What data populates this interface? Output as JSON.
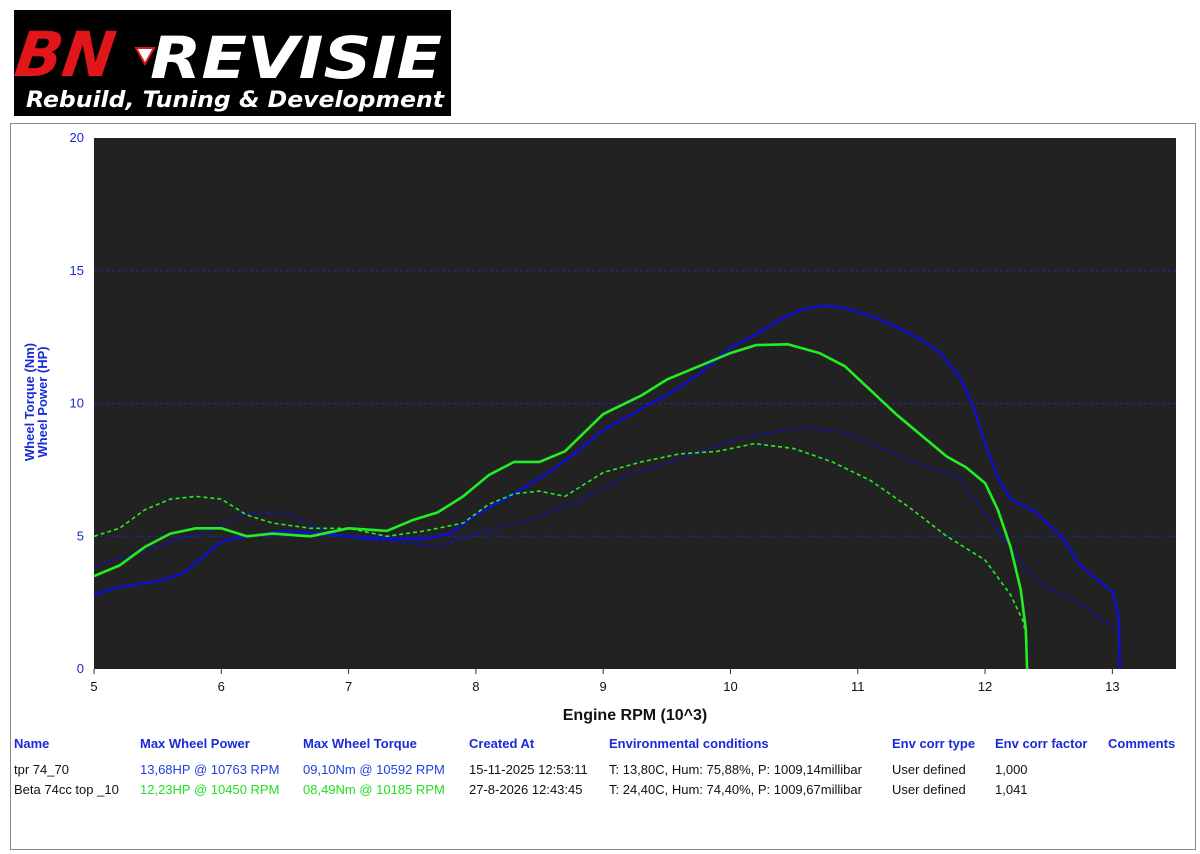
{
  "logo": {
    "brand_red": "BN",
    "brand_white": "REVISIE",
    "tagline": "Rebuild, Tuning & Development"
  },
  "colors": {
    "plot_bg": "#222222",
    "grid": "#1a2ad8",
    "blue": "#1010c8",
    "green": "#22ee22",
    "axis_text": "#1a2ad8"
  },
  "chart_data": {
    "type": "line",
    "xlabel": "Engine RPM (10^3)",
    "ylabel_lines": [
      "Wheel Torque (Nm)",
      "Wheel Power (HP)"
    ],
    "xlim": [
      5,
      13.5
    ],
    "ylim": [
      0,
      20
    ],
    "x_ticks": [
      "5",
      "6",
      "7",
      "8",
      "9",
      "10",
      "11",
      "12",
      "13"
    ],
    "y_ticks": [
      "0",
      "5",
      "10",
      "15",
      "20"
    ],
    "grid": "horizontal dashed",
    "series": [
      {
        "name": "tpr 74_70",
        "metric": "power",
        "color": "blue",
        "dash": false,
        "x": [
          5.0,
          5.2,
          5.5,
          5.7,
          5.85,
          6.0,
          6.2,
          6.5,
          6.8,
          7.0,
          7.3,
          7.6,
          7.8,
          8.0,
          8.3,
          8.6,
          8.8,
          9.0,
          9.3,
          9.6,
          9.8,
          10.0,
          10.2,
          10.4,
          10.6,
          10.76,
          10.9,
          11.1,
          11.3,
          11.5,
          11.65,
          11.8,
          11.9,
          12.0,
          12.1,
          12.2,
          12.4,
          12.6,
          12.75,
          12.9,
          13.0,
          13.05,
          13.06
        ],
        "y": [
          2.8,
          3.1,
          3.3,
          3.6,
          4.2,
          4.8,
          5.0,
          5.2,
          5.1,
          5.0,
          4.9,
          4.9,
          5.1,
          5.8,
          6.6,
          7.5,
          8.2,
          9.0,
          9.8,
          10.6,
          11.3,
          12.1,
          12.6,
          13.2,
          13.6,
          13.68,
          13.6,
          13.3,
          12.9,
          12.4,
          11.9,
          11.0,
          10.0,
          8.5,
          7.2,
          6.4,
          5.9,
          5.0,
          3.9,
          3.3,
          2.9,
          2.0,
          0.0
        ]
      },
      {
        "name": "tpr 74_70",
        "metric": "torque",
        "color": "blue",
        "dash": true,
        "x": [
          5.0,
          5.3,
          5.6,
          5.9,
          6.2,
          6.5,
          6.8,
          7.1,
          7.4,
          7.7,
          8.0,
          8.4,
          8.8,
          9.2,
          9.6,
          10.0,
          10.3,
          10.59,
          10.9,
          11.2,
          11.5,
          11.8,
          12.1,
          12.4,
          12.7,
          13.0,
          13.06
        ],
        "y": [
          3.9,
          4.3,
          4.8,
          5.2,
          5.9,
          5.9,
          5.2,
          4.9,
          4.8,
          4.6,
          5.1,
          5.6,
          6.3,
          7.3,
          7.9,
          8.6,
          8.9,
          9.1,
          8.9,
          8.3,
          7.7,
          7.2,
          5.2,
          3.3,
          2.6,
          1.6,
          1.4
        ]
      },
      {
        "name": "Beta 74cc top _10",
        "metric": "power",
        "color": "green",
        "dash": false,
        "x": [
          5.0,
          5.2,
          5.4,
          5.6,
          5.8,
          6.0,
          6.2,
          6.4,
          6.7,
          7.0,
          7.3,
          7.5,
          7.7,
          7.9,
          8.1,
          8.3,
          8.5,
          8.7,
          9.0,
          9.3,
          9.5,
          9.8,
          10.0,
          10.2,
          10.45,
          10.7,
          10.9,
          11.1,
          11.3,
          11.5,
          11.7,
          11.85,
          12.0,
          12.1,
          12.2,
          12.28,
          12.32,
          12.33
        ],
        "y": [
          3.5,
          3.9,
          4.6,
          5.1,
          5.3,
          5.3,
          5.0,
          5.1,
          5.0,
          5.3,
          5.2,
          5.6,
          5.9,
          6.5,
          7.3,
          7.8,
          7.8,
          8.2,
          9.6,
          10.3,
          10.9,
          11.5,
          11.9,
          12.2,
          12.23,
          11.9,
          11.4,
          10.5,
          9.6,
          8.8,
          8.0,
          7.6,
          7.0,
          6.0,
          4.6,
          3.0,
          1.5,
          0.0
        ]
      },
      {
        "name": "Beta 74cc top _10",
        "metric": "torque",
        "color": "green",
        "dash": true,
        "x": [
          5.0,
          5.2,
          5.4,
          5.6,
          5.8,
          6.0,
          6.2,
          6.4,
          6.7,
          7.0,
          7.3,
          7.6,
          7.9,
          8.1,
          8.3,
          8.5,
          8.7,
          9.0,
          9.3,
          9.6,
          9.9,
          10.19,
          10.5,
          10.8,
          11.1,
          11.4,
          11.7,
          12.0,
          12.2,
          12.3,
          12.33
        ],
        "y": [
          5.0,
          5.3,
          6.0,
          6.4,
          6.5,
          6.4,
          5.8,
          5.5,
          5.3,
          5.3,
          5.0,
          5.2,
          5.5,
          6.2,
          6.6,
          6.7,
          6.5,
          7.4,
          7.8,
          8.1,
          8.2,
          8.49,
          8.3,
          7.8,
          7.1,
          6.1,
          5.0,
          4.1,
          2.8,
          1.8,
          1.0
        ]
      }
    ]
  },
  "results_table": {
    "headers": [
      "Name",
      "Max Wheel Power",
      "Max Wheel Torque",
      "Created At",
      "Environmental conditions",
      "Env corr type",
      "Env corr factor",
      "Comments"
    ],
    "rows": [
      {
        "name": "tpr 74_70",
        "max_power": "13,68HP @ 10763 RPM",
        "max_torque": "09,10Nm @ 10592 RPM",
        "created_at": "15-11-2025 12:53:11",
        "env": "T: 13,80C, Hum: 75,88%, P: 1009,14millibar",
        "corr_type": "User defined",
        "corr_factor": "1,000",
        "comments": ""
      },
      {
        "name": "Beta 74cc top _10",
        "max_power": "12,23HP @ 10450 RPM",
        "max_torque": "08,49Nm @ 10185 RPM",
        "created_at": "27-8-2026 12:43:45",
        "env": "T: 24,40C, Hum: 74,40%, P: 1009,67millibar",
        "corr_type": "User defined",
        "corr_factor": "1,041",
        "comments": ""
      }
    ]
  }
}
